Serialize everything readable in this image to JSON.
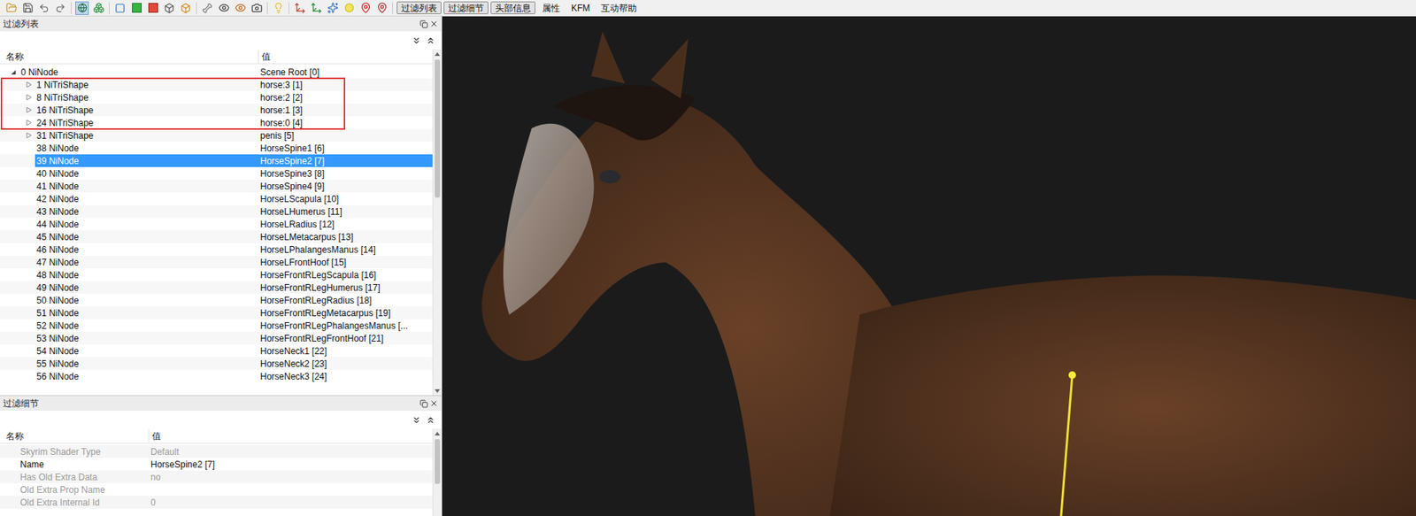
{
  "toolbar": {
    "buttons": [
      {
        "label": "过滤列表",
        "pressed": true
      },
      {
        "label": "过滤细节",
        "pressed": true
      },
      {
        "label": "头部信息",
        "pressed": true
      },
      {
        "label": "属性",
        "pressed": false
      },
      {
        "label": "KFM",
        "pressed": false
      },
      {
        "label": "互动帮助",
        "pressed": false
      }
    ]
  },
  "block_list": {
    "title": "过滤列表",
    "columns": [
      "名称",
      "值"
    ],
    "scrollbar": {
      "thumb_share": 0.42
    },
    "rows": [
      {
        "name": "0 NiNode",
        "value": "Scene Root [0]",
        "depth": 0,
        "has_children": true,
        "expanded": true,
        "selected": false,
        "highlighted": false
      },
      {
        "name": "1 NiTriShape",
        "value": "horse:3 [1]",
        "depth": 1,
        "has_children": true,
        "expanded": false,
        "selected": false,
        "highlighted": true
      },
      {
        "name": "8 NiTriShape",
        "value": "horse:2 [2]",
        "depth": 1,
        "has_children": true,
        "expanded": false,
        "selected": false,
        "highlighted": true
      },
      {
        "name": "16 NiTriShape",
        "value": "horse:1 [3]",
        "depth": 1,
        "has_children": true,
        "expanded": false,
        "selected": false,
        "highlighted": true
      },
      {
        "name": "24 NiTriShape",
        "value": "horse:0 [4]",
        "depth": 1,
        "has_children": true,
        "expanded": false,
        "selected": false,
        "highlighted": true
      },
      {
        "name": "31 NiTriShape",
        "value": "penis [5]",
        "depth": 1,
        "has_children": true,
        "expanded": false,
        "selected": false,
        "highlighted": false
      },
      {
        "name": "38 NiNode",
        "value": "HorseSpine1 [6]",
        "depth": 1,
        "has_children": false,
        "expanded": false,
        "selected": false,
        "highlighted": false
      },
      {
        "name": "39 NiNode",
        "value": "HorseSpine2 [7]",
        "depth": 1,
        "has_children": false,
        "expanded": false,
        "selected": true,
        "highlighted": false
      },
      {
        "name": "40 NiNode",
        "value": "HorseSpine3 [8]",
        "depth": 1,
        "has_children": false,
        "expanded": false,
        "selected": false,
        "highlighted": false
      },
      {
        "name": "41 NiNode",
        "value": "HorseSpine4 [9]",
        "depth": 1,
        "has_children": false,
        "expanded": false,
        "selected": false,
        "highlighted": false
      },
      {
        "name": "42 NiNode",
        "value": "HorseLScapula [10]",
        "depth": 1,
        "has_children": false,
        "expanded": false,
        "selected": false,
        "highlighted": false
      },
      {
        "name": "43 NiNode",
        "value": "HorseLHumerus [11]",
        "depth": 1,
        "has_children": false,
        "expanded": false,
        "selected": false,
        "highlighted": false
      },
      {
        "name": "44 NiNode",
        "value": "HorseLRadius [12]",
        "depth": 1,
        "has_children": false,
        "expanded": false,
        "selected": false,
        "highlighted": false
      },
      {
        "name": "45 NiNode",
        "value": "HorseLMetacarpus [13]",
        "depth": 1,
        "has_children": false,
        "expanded": false,
        "selected": false,
        "highlighted": false
      },
      {
        "name": "46 NiNode",
        "value": "HorseLPhalangesManus [14]",
        "depth": 1,
        "has_children": false,
        "expanded": false,
        "selected": false,
        "highlighted": false
      },
      {
        "name": "47 NiNode",
        "value": "HorseLFrontHoof [15]",
        "depth": 1,
        "has_children": false,
        "expanded": false,
        "selected": false,
        "highlighted": false
      },
      {
        "name": "48 NiNode",
        "value": "HorseFrontRLegScapula [16]",
        "depth": 1,
        "has_children": false,
        "expanded": false,
        "selected": false,
        "highlighted": false
      },
      {
        "name": "49 NiNode",
        "value": "HorseFrontRLegHumerus [17]",
        "depth": 1,
        "has_children": false,
        "expanded": false,
        "selected": false,
        "highlighted": false
      },
      {
        "name": "50 NiNode",
        "value": "HorseFrontRLegRadius [18]",
        "depth": 1,
        "has_children": false,
        "expanded": false,
        "selected": false,
        "highlighted": false
      },
      {
        "name": "51 NiNode",
        "value": "HorseFrontRLegMetacarpus [19]",
        "depth": 1,
        "has_children": false,
        "expanded": false,
        "selected": false,
        "highlighted": false
      },
      {
        "name": "52 NiNode",
        "value": "HorseFrontRLegPhalangesManus [...",
        "depth": 1,
        "has_children": false,
        "expanded": false,
        "selected": false,
        "highlighted": false
      },
      {
        "name": "53 NiNode",
        "value": "HorseFrontRLegFrontHoof [21]",
        "depth": 1,
        "has_children": false,
        "expanded": false,
        "selected": false,
        "highlighted": false
      },
      {
        "name": "54 NiNode",
        "value": "HorseNeck1 [22]",
        "depth": 1,
        "has_children": false,
        "expanded": false,
        "selected": false,
        "highlighted": false
      },
      {
        "name": "55 NiNode",
        "value": "HorseNeck2 [23]",
        "depth": 1,
        "has_children": false,
        "expanded": false,
        "selected": false,
        "highlighted": false
      },
      {
        "name": "56 NiNode",
        "value": "HorseNeck3 [24]",
        "depth": 1,
        "has_children": false,
        "expanded": false,
        "selected": false,
        "highlighted": false
      }
    ]
  },
  "block_details": {
    "title": "过滤细节",
    "columns": [
      "名称",
      "值"
    ],
    "rows": [
      {
        "name": "Skyrim Shader Type",
        "value": "Default",
        "disabled": true
      },
      {
        "name": "Name",
        "value": "HorseSpine2 [7]",
        "disabled": false
      },
      {
        "name": "Has Old Extra Data",
        "value": "no",
        "disabled": true
      },
      {
        "name": "Old Extra Prop Name",
        "value": "",
        "disabled": true
      },
      {
        "name": "Old Extra Internal Id",
        "value": "0",
        "disabled": true
      }
    ]
  }
}
